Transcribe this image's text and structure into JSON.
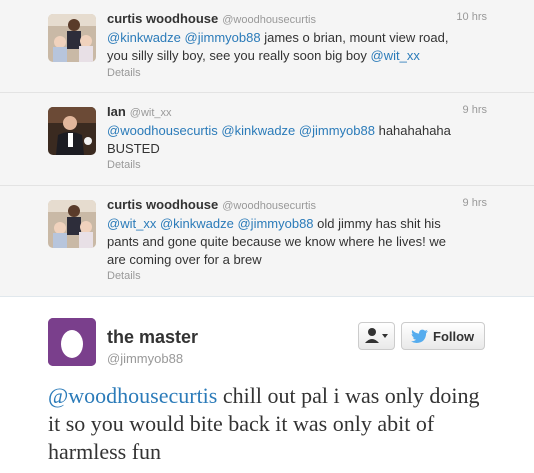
{
  "replies": [
    {
      "name": "curtis woodhouse",
      "handle": "@woodhousecurtis",
      "time": "10 hrs",
      "lines": [
        {
          "mentions": [
            "@kinkwadze",
            "@jimmyob88"
          ],
          "after": " james o brian, mount view road,"
        },
        {
          "text": "you silly silly boy, see you really soon big boy ",
          "mention": "@wit_xx"
        }
      ],
      "details": "Details"
    },
    {
      "name": "Ian",
      "handle": "@wit_xx",
      "time": "9 hrs",
      "lines": [
        {
          "mentions": [
            "@woodhousecurtis",
            "@kinkwadze",
            "@jimmyob88"
          ],
          "after": " hahahahaha"
        },
        {
          "text": "BUSTED"
        }
      ],
      "details": "Details"
    },
    {
      "name": "curtis woodhouse",
      "handle": "@woodhousecurtis",
      "time": "9 hrs",
      "lines": [
        {
          "mentions": [
            "@wit_xx",
            "@kinkwadze",
            "@jimmyob88"
          ],
          "after": " old jimmy has shit his"
        },
        {
          "text": "pants and gone quite because we know where he lives! we"
        },
        {
          "text": "are coming over for a brew"
        }
      ],
      "details": "Details"
    }
  ],
  "main": {
    "name": "the master",
    "handle": "@jimmyob88",
    "follow_label": "Follow",
    "mention": "@woodhousecurtis",
    "text_rest": " chill out pal i was only doing it so you would bite back it was only abit of harmless fun"
  },
  "icons": {
    "user_menu": "user-dropdown-icon",
    "follow": "twitter-bird-icon",
    "avatar_default": "egg-icon"
  },
  "colors": {
    "link": "#2b7bb9",
    "thread_bg": "#f5f5f5",
    "egg_bg": "#7a3f8c",
    "bird": "#55acee"
  }
}
